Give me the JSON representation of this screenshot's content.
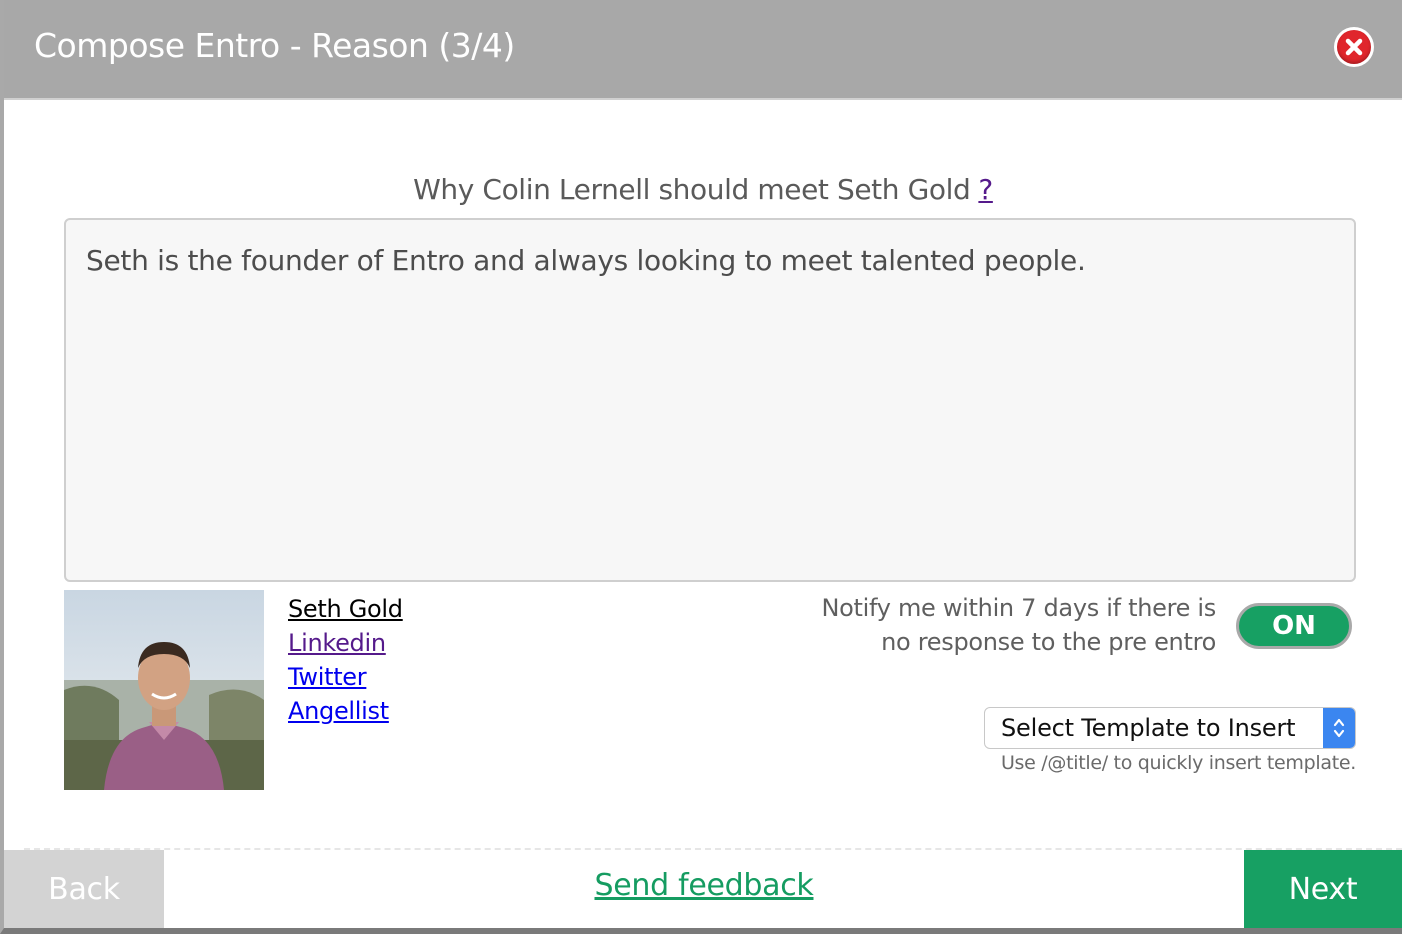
{
  "dialog": {
    "title": "Compose Entro - Reason (3/4)",
    "close_icon": "close-icon"
  },
  "question": {
    "text": "Why Colin Lernell should meet Seth Gold",
    "help_link": "?"
  },
  "reason": {
    "value": "Seth is the founder of Entro and always looking to meet talented people."
  },
  "profile": {
    "photo": "profile-photo",
    "name": "Seth Gold",
    "links": {
      "linkedin": "Linkedin",
      "twitter": "Twitter",
      "angellist": "Angellist"
    }
  },
  "notify": {
    "line1": "Notify me within 7 days if there is",
    "line2": "no response to the pre entro",
    "toggle_label": "ON"
  },
  "template": {
    "selected": "Select Template to Insert",
    "hint": "Use /@title/ to quickly insert template."
  },
  "footer": {
    "back_label": "Back",
    "feedback_label": "Send feedback",
    "next_label": "Next"
  },
  "colors": {
    "header_bg": "#a8a8a8",
    "accent_green": "#17a063",
    "close_red": "#e0262c",
    "select_blue": "#3b86f0"
  }
}
